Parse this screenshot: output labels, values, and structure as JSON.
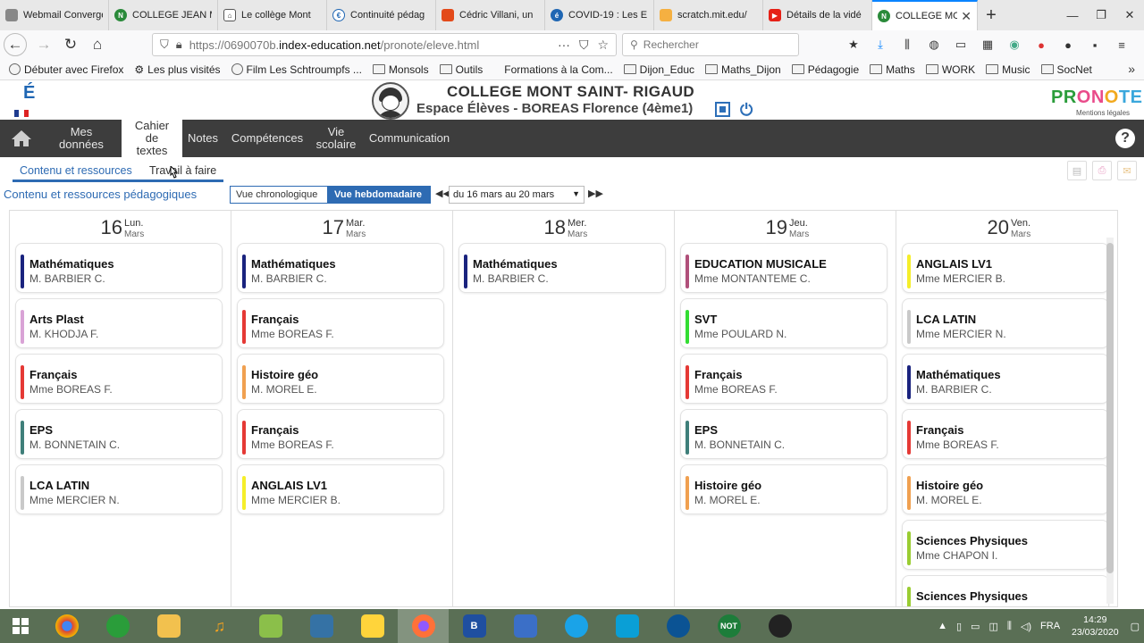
{
  "browser": {
    "tabs": [
      {
        "label": "Webmail Convergenc",
        "icon": "webmail-icon"
      },
      {
        "label": "COLLEGE JEAN M",
        "icon": "note-icon"
      },
      {
        "label": "Le collège Mont",
        "icon": "house-icon"
      },
      {
        "label": "Continuité pédag",
        "icon": "e-icon"
      },
      {
        "label": "Cédric Villani, un",
        "icon": "news-icon"
      },
      {
        "label": "COVID-19 : Les E",
        "icon": "e-icon"
      },
      {
        "label": "scratch.mit.edu/",
        "icon": "page-icon"
      },
      {
        "label": "Détails de la vidé",
        "icon": "youtube-icon"
      },
      {
        "label": "COLLEGE MO",
        "icon": "note-icon"
      }
    ],
    "url_prefix": "https://0690070b.",
    "url_domain": "index-education.net",
    "url_path": "/pronote/eleve.html",
    "search_placeholder": "Rechercher",
    "bookmarks": [
      "Débuter avec Firefox",
      "Les plus visités",
      "Film Les Schtroumpfs ...",
      "Monsols",
      "Outils",
      "Formations à la Com...",
      "Dijon_Educ",
      "Maths_Dijon",
      "Pédagogie",
      "Maths",
      "WORK",
      "Music",
      "SocNet"
    ]
  },
  "header": {
    "school": "COLLEGE MONT SAINT- RIGAUD",
    "space": "Espace Élèves - BOREAS Florence (4ème1)",
    "pronote": "PRONOTE",
    "mentions": "Mentions légales"
  },
  "menu": {
    "items": [
      {
        "label": "Mes données"
      },
      {
        "label": "Cahier de textes"
      },
      {
        "label": "Notes"
      },
      {
        "label": "Compétences"
      },
      {
        "label": "Vie scolaire"
      },
      {
        "label": "Communication"
      }
    ]
  },
  "subtabs": {
    "tab1": "Contenu et ressources",
    "tab2": "Travail à faire"
  },
  "toolbar": {
    "title": "Contenu et ressources pédagogiques",
    "view_chrono": "Vue chronologique",
    "view_hebdo": "Vue hebdomadaire",
    "date_range": "du 16 mars au 20 mars"
  },
  "week": {
    "days": [
      {
        "num": "16",
        "name": "Lun.",
        "month": "Mars",
        "courses": [
          {
            "subject": "Mathématiques",
            "teacher": "M. BARBIER C.",
            "color": "#1a237e"
          },
          {
            "subject": "Arts Plast",
            "teacher": "M. KHODJA F.",
            "color": "#d9a3d6"
          },
          {
            "subject": "Français",
            "teacher": "Mme BOREAS F.",
            "color": "#e53935"
          },
          {
            "subject": "EPS",
            "teacher": "M. BONNETAIN C.",
            "color": "#3f7f7a"
          },
          {
            "subject": "LCA LATIN",
            "teacher": "Mme MERCIER N.",
            "color": "#c9c9c9"
          }
        ]
      },
      {
        "num": "17",
        "name": "Mar.",
        "month": "Mars",
        "courses": [
          {
            "subject": "Mathématiques",
            "teacher": "M. BARBIER C.",
            "color": "#1a237e"
          },
          {
            "subject": "Français",
            "teacher": "Mme BOREAS F.",
            "color": "#e53935"
          },
          {
            "subject": "Histoire géo",
            "teacher": "M. MOREL E.",
            "color": "#f0a050"
          },
          {
            "subject": "Français",
            "teacher": "Mme BOREAS F.",
            "color": "#e53935"
          },
          {
            "subject": "ANGLAIS LV1",
            "teacher": "Mme MERCIER B.",
            "color": "#f5ee2a"
          }
        ]
      },
      {
        "num": "18",
        "name": "Mer.",
        "month": "Mars",
        "courses": [
          {
            "subject": "Mathématiques",
            "teacher": "M. BARBIER C.",
            "color": "#1a237e"
          }
        ]
      },
      {
        "num": "19",
        "name": "Jeu.",
        "month": "Mars",
        "courses": [
          {
            "subject": "EDUCATION MUSICALE",
            "teacher": "Mme MONTANTEME C.",
            "color": "#b0507a"
          },
          {
            "subject": "SVT",
            "teacher": "Mme POULARD N.",
            "color": "#33dd33"
          },
          {
            "subject": "Français",
            "teacher": "Mme BOREAS F.",
            "color": "#e53935"
          },
          {
            "subject": "EPS",
            "teacher": "M. BONNETAIN C.",
            "color": "#3f7f7a"
          },
          {
            "subject": "Histoire géo",
            "teacher": "M. MOREL E.",
            "color": "#f0a050"
          }
        ]
      },
      {
        "num": "20",
        "name": "Ven.",
        "month": "Mars",
        "courses": [
          {
            "subject": "ANGLAIS LV1",
            "teacher": "Mme MERCIER B.",
            "color": "#f5ee2a"
          },
          {
            "subject": "LCA LATIN",
            "teacher": "Mme MERCIER N.",
            "color": "#c9c9c9"
          },
          {
            "subject": "Mathématiques",
            "teacher": "M. BARBIER C.",
            "color": "#1a237e"
          },
          {
            "subject": "Français",
            "teacher": "Mme BOREAS F.",
            "color": "#e53935"
          },
          {
            "subject": "Histoire géo",
            "teacher": "M. MOREL E.",
            "color": "#f0a050"
          },
          {
            "subject": "Sciences Physiques",
            "teacher": "Mme CHAPON I.",
            "color": "#9acd32"
          },
          {
            "subject": "Sciences Physiques",
            "teacher": "",
            "color": "#9acd32"
          }
        ]
      }
    ]
  },
  "taskbar": {
    "lang": "FRA",
    "time": "14:29",
    "date": "23/03/2020"
  }
}
